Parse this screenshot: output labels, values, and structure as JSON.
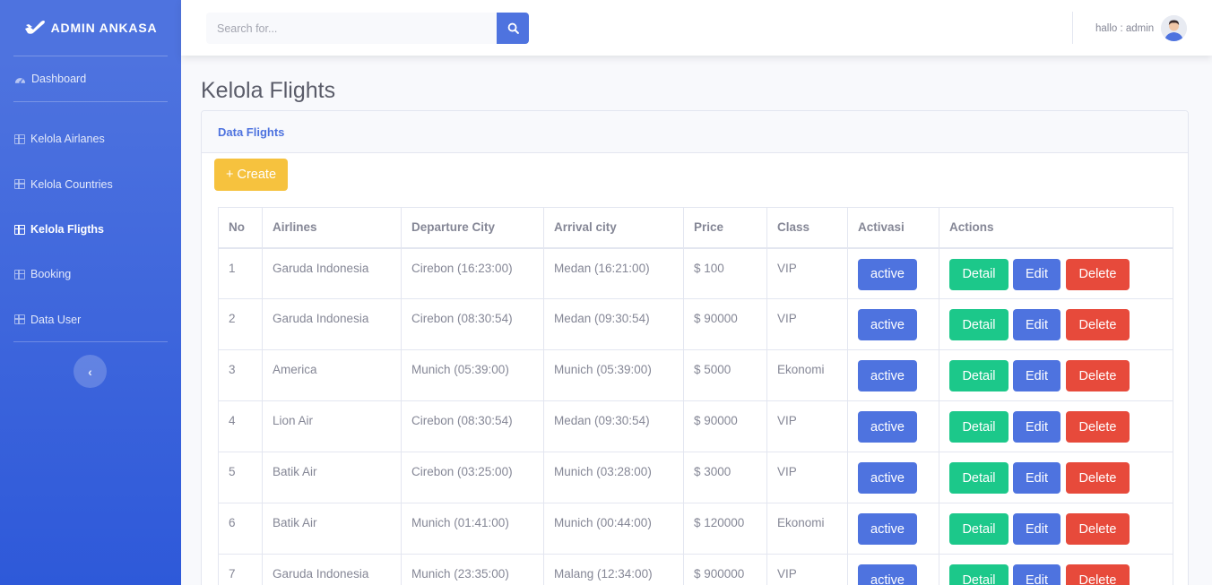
{
  "brand": {
    "name": "ADMIN ANKASA"
  },
  "sidebar": {
    "items": [
      {
        "label": "Dashboard",
        "icon": "dashboard-icon",
        "active": false
      },
      {
        "label": "Kelola Airlanes",
        "icon": "table-icon",
        "active": false
      },
      {
        "label": "Kelola Countries",
        "icon": "table-icon",
        "active": false
      },
      {
        "label": "Kelola Fligths",
        "icon": "table-icon",
        "active": true
      },
      {
        "label": "Booking",
        "icon": "table-icon",
        "active": false
      },
      {
        "label": "Data User",
        "icon": "table-icon",
        "active": false
      }
    ],
    "toggle_icon": "chevron-left-icon"
  },
  "topbar": {
    "search_placeholder": "Search for...",
    "search_icon": "search-icon",
    "user_greeting": "hallo : admin"
  },
  "page": {
    "title": "Kelola Flights",
    "card_title": "Data Flights",
    "create_label": "+ Create"
  },
  "table": {
    "headers": [
      "No",
      "Airlines",
      "Departure City",
      "Arrival city",
      "Price",
      "Class",
      "Activasi",
      "Actions"
    ],
    "rows": [
      {
        "no": "1",
        "airline": "Garuda Indonesia",
        "departure": "Cirebon (16:23:00)",
        "arrival": "Medan (16:21:00)",
        "price": "$ 100",
        "class": "VIP",
        "status": "active"
      },
      {
        "no": "2",
        "airline": "Garuda Indonesia",
        "departure": "Cirebon (08:30:54)",
        "arrival": "Medan (09:30:54)",
        "price": "$ 90000",
        "class": "VIP",
        "status": "active"
      },
      {
        "no": "3",
        "airline": "America",
        "departure": "Munich (05:39:00)",
        "arrival": "Munich (05:39:00)",
        "price": "$ 5000",
        "class": "Ekonomi",
        "status": "active"
      },
      {
        "no": "4",
        "airline": "Lion Air",
        "departure": "Cirebon (08:30:54)",
        "arrival": "Medan (09:30:54)",
        "price": "$ 90000",
        "class": "VIP",
        "status": "active"
      },
      {
        "no": "5",
        "airline": "Batik Air",
        "departure": "Cirebon (03:25:00)",
        "arrival": "Munich (03:28:00)",
        "price": "$ 3000",
        "class": "VIP",
        "status": "active"
      },
      {
        "no": "6",
        "airline": "Batik Air",
        "departure": "Munich (01:41:00)",
        "arrival": "Munich (00:44:00)",
        "price": "$ 120000",
        "class": "Ekonomi",
        "status": "active"
      },
      {
        "no": "7",
        "airline": "Garuda Indonesia",
        "departure": "Munich (23:35:00)",
        "arrival": "Malang (12:34:00)",
        "price": "$ 900000",
        "class": "VIP",
        "status": "active"
      }
    ],
    "action_labels": {
      "detail": "Detail",
      "edit": "Edit",
      "delete": "Delete"
    }
  },
  "colors": {
    "primary": "#4e73df",
    "success": "#1cc88a",
    "danger": "#e74a3b",
    "warning": "#f6c23e",
    "text": "#858796"
  }
}
